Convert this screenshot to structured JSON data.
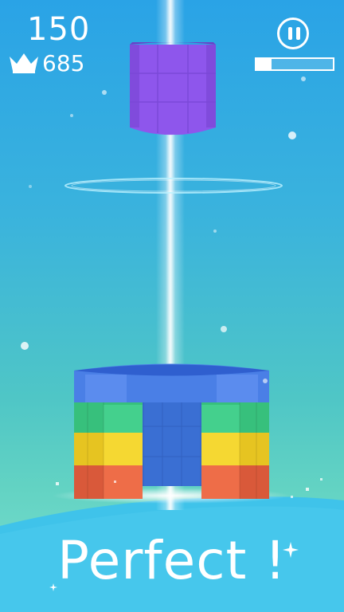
{
  "hud": {
    "score": "150",
    "best_score": "685",
    "crown_icon": "crown-icon",
    "pause_icon": "pause-icon",
    "level_progress": 0.2
  },
  "message": {
    "text": "Perfect !"
  },
  "colors": {
    "falling_block": "#9b5cf0",
    "tower_blue": "#3f7fe0",
    "tower_green": "#3ccf8a",
    "tower_yellow": "#f2d32a",
    "tower_red": "#ec6a45",
    "beam": "#ffffff"
  }
}
